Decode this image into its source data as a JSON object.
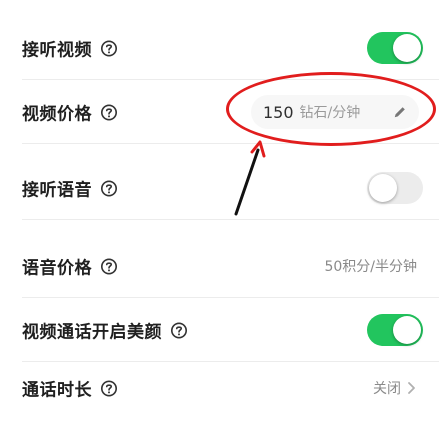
{
  "rows": [
    {
      "label": "接听视频",
      "control": "toggle",
      "state": "on"
    },
    {
      "label": "视频价格",
      "control": "price",
      "price_value": "150",
      "price_unit": "钻石/分钟"
    },
    {
      "label": "接听语音",
      "control": "toggle",
      "state": "off"
    },
    {
      "label": "语音价格",
      "value_text": "50积分/半分钟"
    },
    {
      "label": "视频通话开启美颜",
      "control": "toggle",
      "state": "on"
    },
    {
      "label": "通话时长",
      "value_text": "关闭"
    }
  ],
  "icons": {
    "help": "help-circle-icon",
    "edit": "pencil-icon",
    "chevron": "chevron-right-icon"
  },
  "colors": {
    "toggle_on": "#22c55e",
    "toggle_off": "#ececec",
    "annotation": "#e11d1d"
  }
}
